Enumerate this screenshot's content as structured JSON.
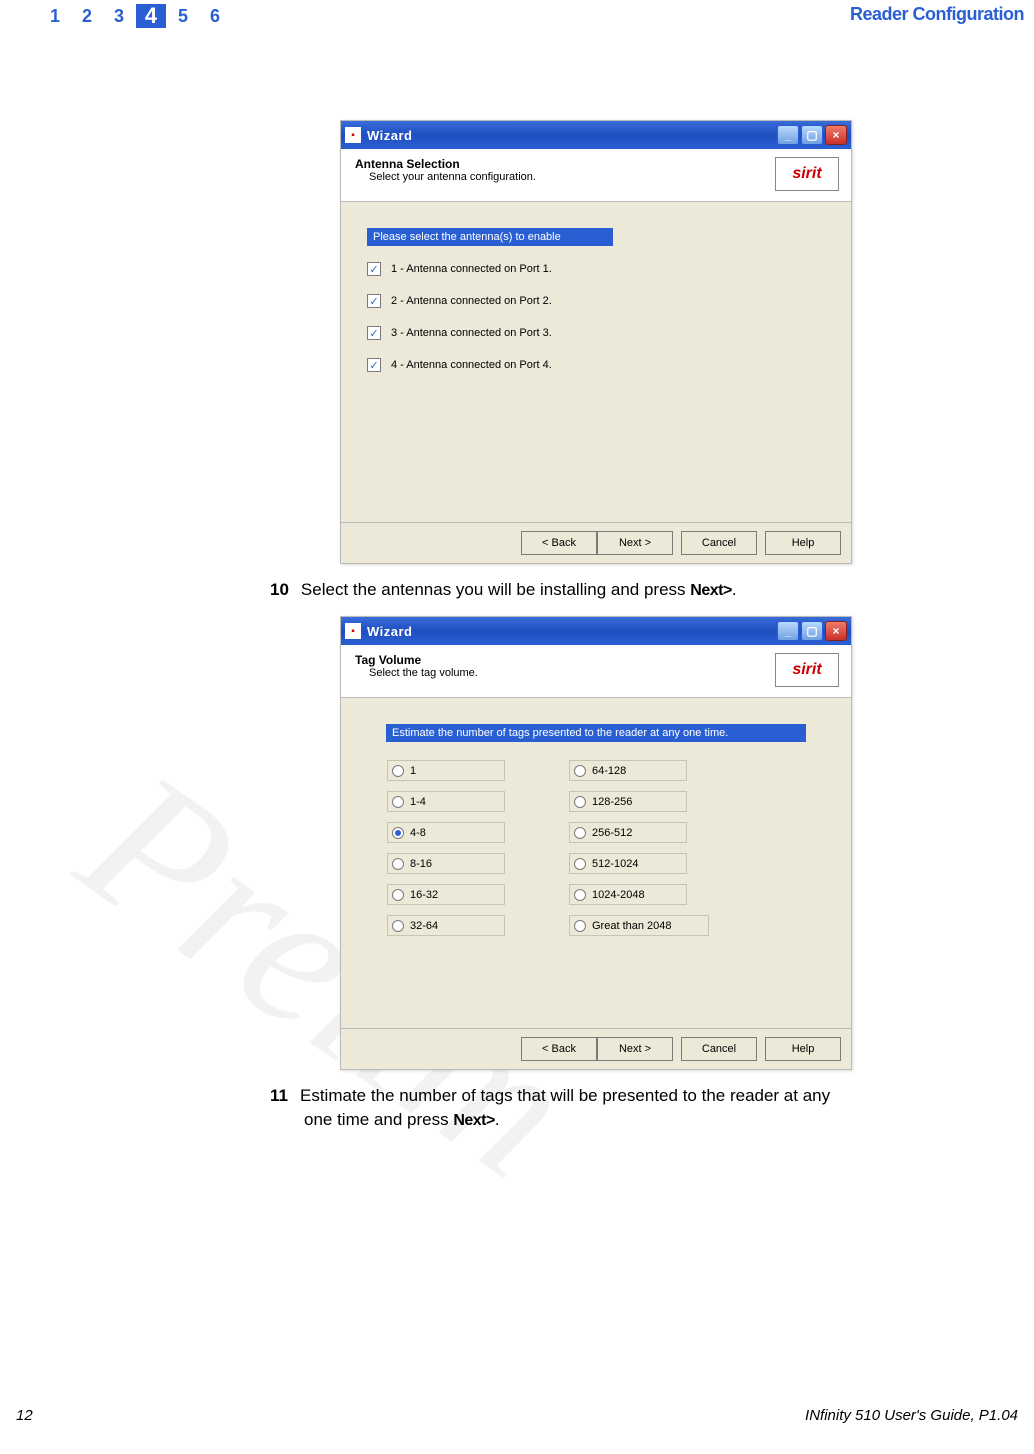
{
  "header": {
    "tabs": [
      "1",
      "2",
      "3",
      "4",
      "5",
      "6"
    ],
    "activeIndex": 3,
    "section": "Reader Configuration"
  },
  "wizard1": {
    "title": "Wizard",
    "headerTitle": "Antenna Selection",
    "headerSub": "Select your antenna configuration.",
    "logoText": "sirit",
    "logoSub": "",
    "prompt": "Please select the antenna(s) to enable",
    "items": [
      {
        "checked": true,
        "label": "1 - Antenna connected on Port 1."
      },
      {
        "checked": true,
        "label": "2 - Antenna connected on Port 2."
      },
      {
        "checked": true,
        "label": "3 - Antenna connected on Port 3."
      },
      {
        "checked": true,
        "label": "4 - Antenna connected on Port 4."
      }
    ],
    "buttons": {
      "back": "< Back",
      "next": "Next >",
      "cancel": "Cancel",
      "help": "Help"
    }
  },
  "step10": {
    "num": "10",
    "text": "Select the antennas you will be installing and press ",
    "bold": "Next>",
    "suffix": "."
  },
  "wizard2": {
    "title": "Wizard",
    "headerTitle": "Tag Volume",
    "headerSub": "Select the tag volume.",
    "logoText": "sirit",
    "logoSub": "",
    "prompt": "Estimate the number of tags presented to the reader at any one time.",
    "col1": [
      {
        "label": "1",
        "sel": false
      },
      {
        "label": "1-4",
        "sel": false
      },
      {
        "label": "4-8",
        "sel": true
      },
      {
        "label": "8-16",
        "sel": false
      },
      {
        "label": "16-32",
        "sel": false
      },
      {
        "label": "32-64",
        "sel": false
      }
    ],
    "col2": [
      {
        "label": "64-128",
        "sel": false
      },
      {
        "label": "128-256",
        "sel": false
      },
      {
        "label": "256-512",
        "sel": false
      },
      {
        "label": "512-1024",
        "sel": false
      },
      {
        "label": "1024-2048",
        "sel": false
      },
      {
        "label": "Great than 2048",
        "sel": false
      }
    ],
    "buttons": {
      "back": "< Back",
      "next": "Next >",
      "cancel": "Cancel",
      "help": "Help"
    }
  },
  "step11": {
    "num": "11",
    "line1a": "Estimate the number of tags that will be presented to the reader at any",
    "line2a": "one time and press ",
    "bold": "Next>",
    "suffix": "."
  },
  "footer": {
    "pageNum": "12",
    "guidePrefix": "IN",
    "guideRest": "finity 510 User's Guide, P1.04"
  }
}
